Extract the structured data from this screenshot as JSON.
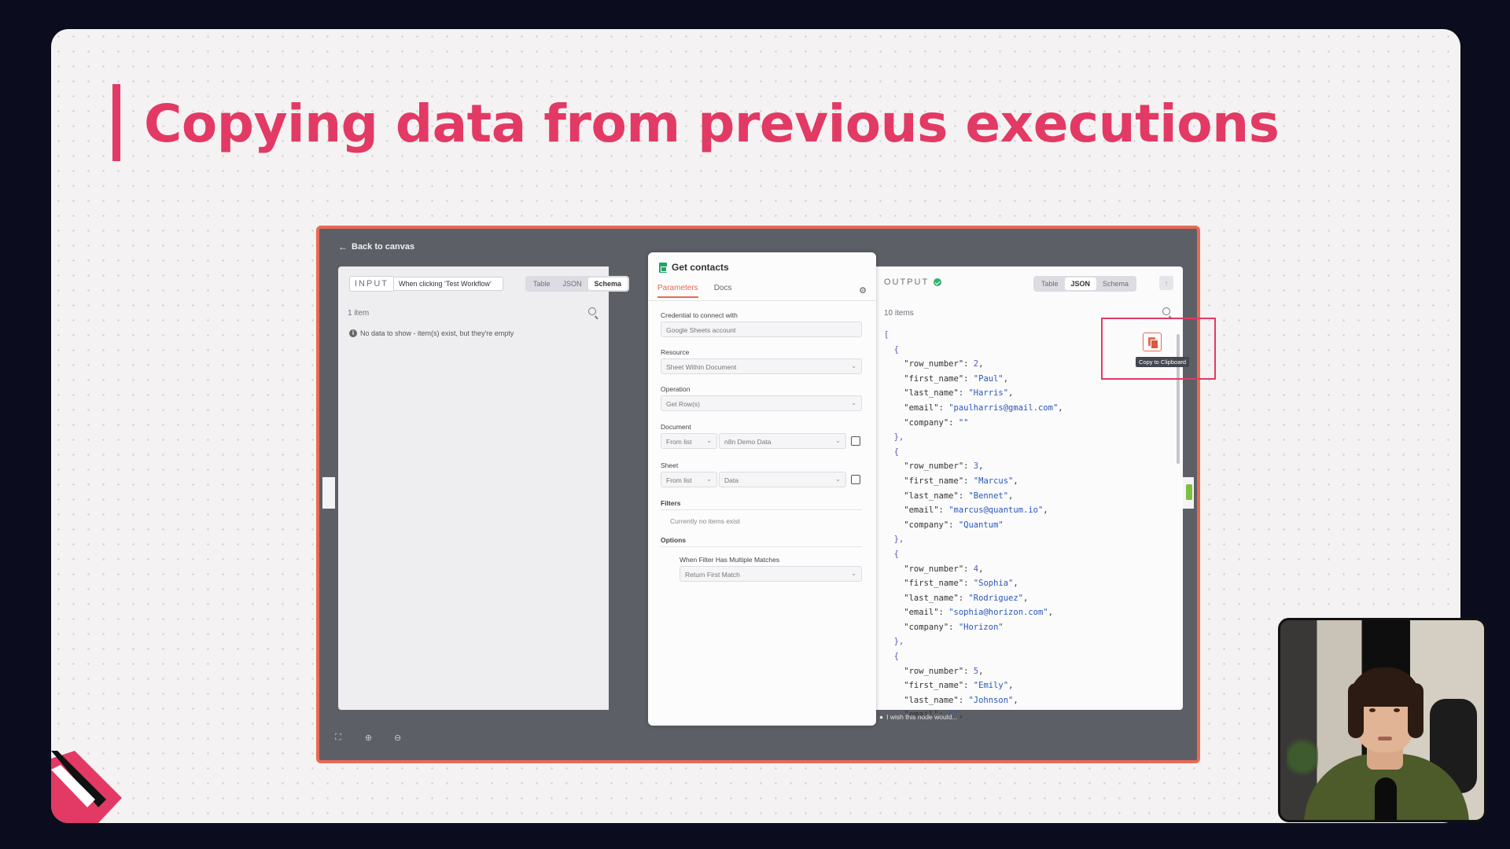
{
  "slide": {
    "title": "Copying data from previous executions",
    "accent_color": "#e23a64"
  },
  "editor": {
    "back_label": "Back to canvas",
    "input": {
      "label": "INPUT",
      "source": "When clicking ‘Test Workflow’",
      "views": [
        "Table",
        "JSON",
        "Schema"
      ],
      "active_view": "Schema",
      "count": "1 item",
      "message": "No data to show - item(s) exist, but they're empty"
    },
    "node": {
      "title": "Get contacts",
      "tabs": [
        "Parameters",
        "Docs"
      ],
      "active_tab": "Parameters",
      "credential_label": "Credential to connect with",
      "credential_value": "Google Sheets account",
      "resource_label": "Resource",
      "resource_value": "Sheet Within Document",
      "operation_label": "Operation",
      "operation_value": "Get Row(s)",
      "document_label": "Document",
      "document_mode": "From list",
      "document_value": "n8n Demo Data",
      "sheet_label": "Sheet",
      "sheet_mode": "From list",
      "sheet_value": "Data",
      "filters_label": "Filters",
      "filters_empty": "Currently no items exist",
      "options_label": "Options",
      "multi_match_label": "When Filter Has Multiple Matches",
      "multi_match_value": "Return First Match"
    },
    "output": {
      "label": "OUTPUT",
      "views": [
        "Table",
        "JSON",
        "Schema"
      ],
      "active_view": "JSON",
      "count": "10 items",
      "copy_tooltip": "Copy to Clipboard",
      "footer": "I wish this node would...",
      "records": [
        {
          "row_number": "2",
          "first_name": "Paul",
          "last_name": "Harris",
          "email": "paulharris@gmail.com",
          "company": ""
        },
        {
          "row_number": "3",
          "first_name": "Marcus",
          "last_name": "Bennet",
          "email": "marcus@quantum.io",
          "company": "Quantum"
        },
        {
          "row_number": "4",
          "first_name": "Sophia",
          "last_name": "Rodriguez",
          "email": "sophia@horizon.com",
          "company": "Horizon"
        },
        {
          "row_number": "5",
          "first_name": "Emily",
          "last_name": "Johnson",
          "email": ""
        }
      ]
    }
  }
}
